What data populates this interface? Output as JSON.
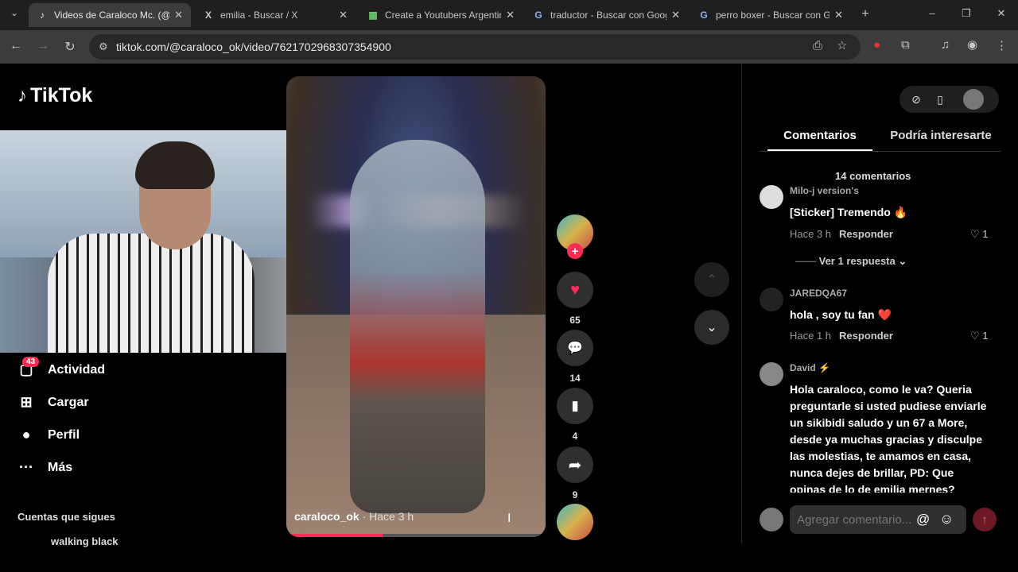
{
  "browser": {
    "tabs": [
      {
        "title": "Videos de Caraloco Mc. (@c",
        "icon": "tiktok-icon",
        "active": true
      },
      {
        "title": "emilia - Buscar / X",
        "icon": "x-icon",
        "active": false
      },
      {
        "title": "Create a Youtubers Argentin",
        "icon": "tier-icon",
        "active": false
      },
      {
        "title": "traductor - Buscar con Goog",
        "icon": "google-icon",
        "active": false
      },
      {
        "title": "perro boxer - Buscar con Go",
        "icon": "google-icon",
        "active": false
      }
    ],
    "url": "tiktok.com/@caraloco_ok/video/7621702968307354900"
  },
  "logo": "TikTok",
  "nav": {
    "items": [
      {
        "label": "Actividad",
        "icon": "inbox-icon",
        "badge": "43"
      },
      {
        "label": "Cargar",
        "icon": "plus-square-icon"
      },
      {
        "label": "Perfil",
        "icon": "avatar-icon"
      },
      {
        "label": "Más",
        "icon": "more-icon"
      }
    ],
    "following_title": "Cuentas que sigues",
    "following_first": "walking black"
  },
  "video": {
    "author": "caraloco_ok",
    "time": "· Hace 3 h",
    "progress": 0.37
  },
  "actions": {
    "likes": "65",
    "comments": "14",
    "saves": "4",
    "shares": "9"
  },
  "panel": {
    "tab_comments": "Comentarios",
    "tab_interest": "Podría interesarte",
    "count": "14 comentarios",
    "comments": [
      {
        "user": "Milo-j version's",
        "text": "[Sticker] Tremendo 🔥",
        "time": "Hace 3 h",
        "reply": "Responder",
        "likes": "1"
      },
      {
        "user": "JAREDQA67",
        "text": "hola , soy tu fan ❤️",
        "time": "Hace 1 h",
        "reply": "Responder",
        "likes": "1"
      },
      {
        "user": "David ⚡",
        "text": "Hola caraloco, como le va? Queria preguntarle si usted pudiese enviarle un sikibidi saludo y un 67 a More, desde ya muchas gracias y disculpe las molestias, te amamos en casa, nunca dejes de brillar, PD: Que opinas de lo de emilia mernes?"
      }
    ],
    "view_replies": "Ver 1 respuesta",
    "input_placeholder": "Agregar comentario...",
    "accent": "#fe2c55"
  }
}
